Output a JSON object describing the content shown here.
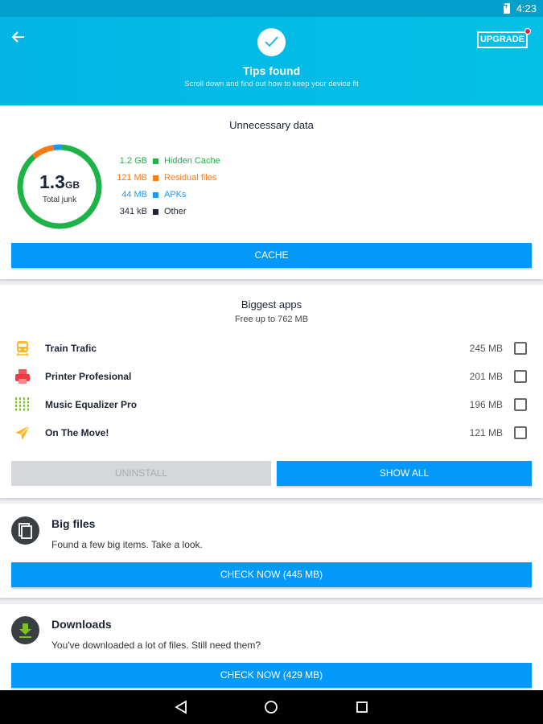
{
  "status_bar": {
    "time": "4:23",
    "battery_icon": "battery-charging-icon"
  },
  "header": {
    "back_icon": "arrow-left-icon",
    "check_icon": "checkmark-icon",
    "title": "Tips found",
    "subtitle": "Scroll down and find out how to keep your device fit",
    "upgrade_label": "UPGRADE",
    "upgrade_badge": true
  },
  "unnecessary_data": {
    "title": "Unnecessary data",
    "total_value": "1.3",
    "total_unit": "GB",
    "total_label": "Total junk",
    "legend": [
      {
        "value": "1.2 GB",
        "label": "Hidden Cache",
        "color": "#1db347"
      },
      {
        "value": "121 MB",
        "label": "Residual files",
        "color": "#fa7a14"
      },
      {
        "value": "44 MB",
        "label": "APKs",
        "color": "#1a9af5"
      },
      {
        "value": "341 kB",
        "label": "Other",
        "color": "#1d2436"
      }
    ],
    "button_label": "CACHE"
  },
  "chart_data": {
    "type": "pie",
    "title": "Total junk 1.3 GB",
    "categories": [
      "Hidden Cache",
      "Residual files",
      "APKs",
      "Other"
    ],
    "values": [
      1200,
      121,
      44,
      0.341
    ],
    "units": "MB",
    "colors": [
      "#1db347",
      "#fa7a14",
      "#1a9af5",
      "#1d2436"
    ]
  },
  "biggest_apps": {
    "title": "Biggest apps",
    "subtitle": "Free up to 762 MB",
    "apps": [
      {
        "name": "Train Trafic",
        "size": "245 MB",
        "icon": "train-icon",
        "checked": false
      },
      {
        "name": "Printer Profesional",
        "size": "201 MB",
        "icon": "printer-icon",
        "checked": false
      },
      {
        "name": "Music Equalizer Pro",
        "size": "196 MB",
        "icon": "equalizer-icon",
        "checked": false
      },
      {
        "name": "On The Move!",
        "size": "121 MB",
        "icon": "airplane-icon",
        "checked": false
      }
    ],
    "uninstall_label": "UNINSTALL",
    "show_all_label": "SHOW ALL"
  },
  "big_files": {
    "title": "Big files",
    "description": "Found a few big items. Take a look.",
    "button_label": "CHECK NOW (445 MB)",
    "icon": "copy-files-icon"
  },
  "downloads": {
    "title": "Downloads",
    "description": "You've downloaded a lot of files. Still need them?",
    "button_label": "CHECK NOW (429 MB)",
    "icon": "download-icon"
  },
  "nav_bar": {
    "back": "nav-back-icon",
    "home": "nav-home-icon",
    "recents": "nav-recents-icon"
  }
}
